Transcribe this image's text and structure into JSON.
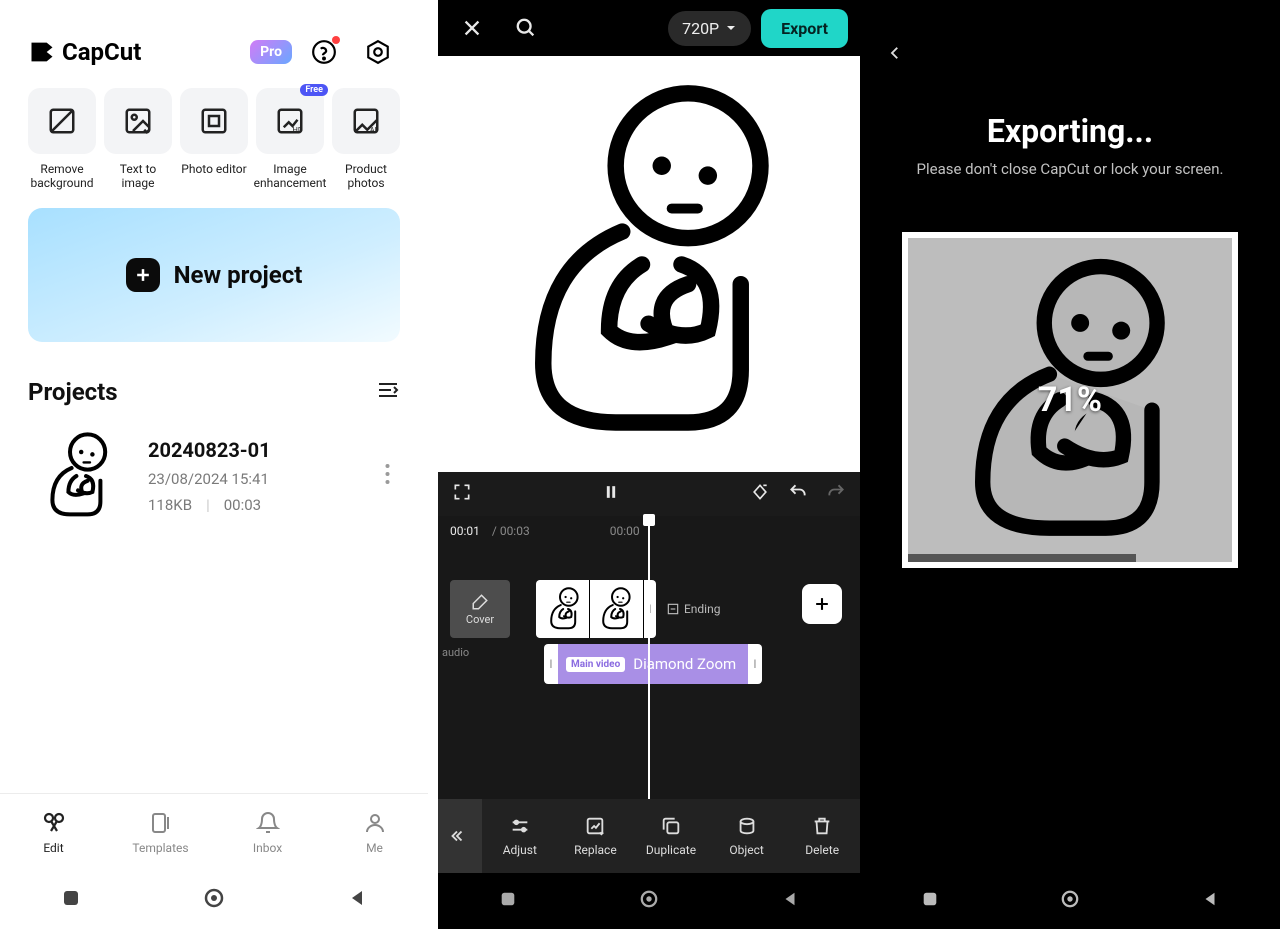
{
  "panel1": {
    "app_name": "CapCut",
    "pro_badge": "Pro",
    "tools": [
      {
        "label": "Remove background"
      },
      {
        "label": "Text to image"
      },
      {
        "label": "Photo editor"
      },
      {
        "label": "Image enhancement",
        "tag": "Free"
      },
      {
        "label": "Product photos"
      }
    ],
    "new_project_label": "New project",
    "projects_heading": "Projects",
    "project": {
      "name": "20240823-01",
      "date": "23/08/2024 15:41",
      "size": "118KB",
      "duration": "00:03"
    },
    "bottom_nav": {
      "edit": "Edit",
      "templates": "Templates",
      "inbox": "Inbox",
      "me": "Me"
    }
  },
  "panel2": {
    "resolution": "720P",
    "export_label": "Export",
    "time_current": "00:01",
    "time_total": "/ 00:03",
    "time_tick": "00:00",
    "cover_label": "Cover",
    "ending_label": "Ending",
    "audio_label": "audio",
    "effect_tag": "Main video",
    "effect_name": "Diamond Zoom",
    "toolbar": {
      "adjust": "Adjust",
      "replace": "Replace",
      "duplicate": "Duplicate",
      "object": "Object",
      "delete": "Delete"
    }
  },
  "panel3": {
    "title": "Exporting...",
    "subtitle": "Please don't close CapCut or lock your screen.",
    "percent": "71%"
  }
}
